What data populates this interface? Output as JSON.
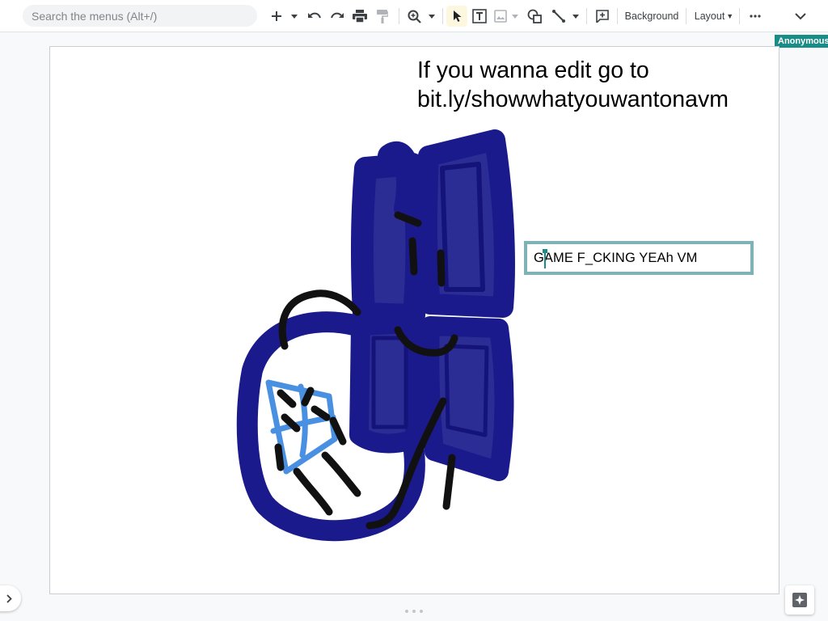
{
  "toolbar": {
    "search_placeholder": "Search the menus (Alt+/)",
    "background_label": "Background",
    "layout_label": "Layout",
    "icons": [
      "plus-icon",
      "caret-icon",
      "undo-icon",
      "redo-icon",
      "print-icon",
      "paint-format-icon",
      "zoom-icon",
      "select-icon",
      "textbox-icon",
      "image-icon",
      "shape-icon",
      "line-icon",
      "comment-icon",
      "more-icon",
      "collapse-icon"
    ]
  },
  "presence": {
    "user_label": "Anonymous"
  },
  "slide": {
    "headline_line1": "If you wanna edit go to",
    "headline_line2": "bit.ly/showwhatyouwantonavm",
    "textbox_text": "GAME F_CKING YEAh VM"
  },
  "colors": {
    "drawing_navy": "#1a1a8c",
    "drawing_blue": "#4a90e2",
    "drawing_black": "#111111",
    "textbox_border": "#7fb2b4",
    "accent_teal": "#188c86"
  }
}
